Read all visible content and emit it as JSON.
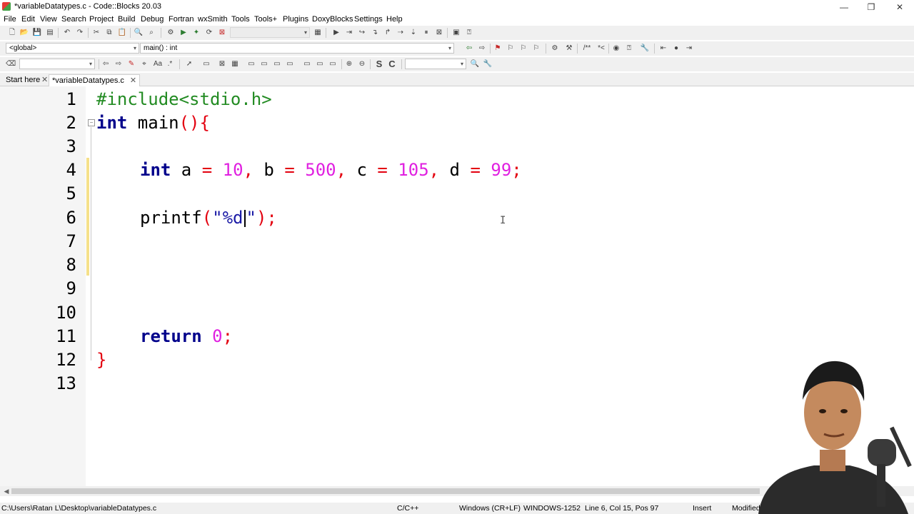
{
  "window": {
    "title": "*variableDatatypes.c - Code::Blocks 20.03",
    "minimize_glyph": "—",
    "restore_glyph": "❐",
    "close_glyph": "✕"
  },
  "menu": [
    "File",
    "Edit",
    "View",
    "Search",
    "Project",
    "Build",
    "Debug",
    "Fortran",
    "wxSmith",
    "Tools",
    "Tools+",
    "Plugins",
    "DoxyBlocks",
    "Settings",
    "Help"
  ],
  "toolbar": {
    "scope_combo": "<global>",
    "function_combo": "main() : int",
    "search_combo": "",
    "find_combo": ""
  },
  "tabs": {
    "start_here": "Start here",
    "active_file": "*variableDatatypes.c",
    "close_glyph": "✕"
  },
  "editor": {
    "line_numbers": [
      "1",
      "2",
      "3",
      "4",
      "5",
      "6",
      "7",
      "8",
      "9",
      "10",
      "11",
      "12",
      "13"
    ],
    "line1": {
      "include": "#include<stdio.h>"
    },
    "line2": {
      "type": "int",
      "name": " main",
      "paren": "()",
      "brace": "{"
    },
    "line4": {
      "type": "int",
      "a": " a ",
      "eq1": "=",
      "v1": " 10",
      "c1": ",",
      "b": " b ",
      "eq2": "=",
      "v2": " 500",
      "c2": ",",
      "c": " c ",
      "eq3": "=",
      "v3": " 105",
      "c3": ",",
      "d": " d ",
      "eq4": "=",
      "v4": " 99",
      "semi": ";"
    },
    "line6": {
      "fn": "printf",
      "open": "(",
      "str_a": "\"%d",
      "str_b": "\"",
      "close": ")",
      "semi": ";"
    },
    "line11": {
      "kw": "return",
      "val": " 0",
      "semi": ";"
    },
    "line12": {
      "brace": "}"
    },
    "fold_marker": "−"
  },
  "statusbar": {
    "path": "C:\\Users\\Ratan L\\Desktop\\variableDatatypes.c",
    "language": "C/C++",
    "line_endings": "Windows (CR+LF)",
    "encoding": "WINDOWS-1252",
    "position": "Line 6, Col 15, Pos 97",
    "mode": "Insert",
    "modified": "Modified"
  },
  "icons": [
    "new-file-icon",
    "open-icon",
    "save-icon",
    "save-all-icon",
    "undo-icon",
    "redo-icon",
    "cut-icon",
    "copy-icon",
    "paste-icon",
    "find-icon",
    "replace-icon",
    "build-icon",
    "run-icon",
    "build-run-icon",
    "rebuild-icon",
    "abort-icon",
    "debug-run-icon",
    "bookmark-icon",
    "zoom-in-icon",
    "zoom-out-icon"
  ],
  "colors": {
    "keyword": "#00008b",
    "preprocessor": "#228b22",
    "number": "#e020e0",
    "operator": "#e3000f",
    "string": "#1a1aa6",
    "gutter": "#f5f5f5",
    "change_marker": "#f5e08a"
  }
}
